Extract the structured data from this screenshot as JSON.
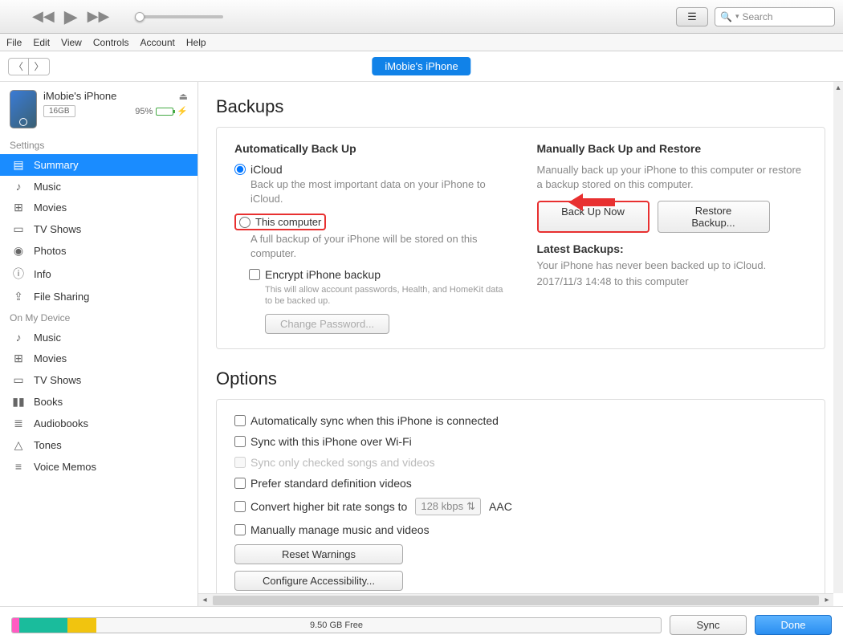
{
  "window": {
    "minimize": "–",
    "maximize": "☐",
    "close": "✕"
  },
  "toolbar": {
    "search_placeholder": "Search"
  },
  "menu": [
    "File",
    "Edit",
    "View",
    "Controls",
    "Account",
    "Help"
  ],
  "device_pill": "iMobie's iPhone",
  "device": {
    "name": "iMobie's iPhone",
    "capacity": "16GB",
    "battery_pct": "95%",
    "battery_fill": 95
  },
  "sidebar": {
    "settings_label": "Settings",
    "settings": [
      {
        "icon": "▤",
        "label": "Summary",
        "active": true
      },
      {
        "icon": "♪",
        "label": "Music"
      },
      {
        "icon": "⊞",
        "label": "Movies"
      },
      {
        "icon": "▭",
        "label": "TV Shows"
      },
      {
        "icon": "◉",
        "label": "Photos"
      },
      {
        "icon": "ⓘ",
        "label": "Info"
      },
      {
        "icon": "⇪",
        "label": "File Sharing"
      }
    ],
    "device_label": "On My Device",
    "device_items": [
      {
        "icon": "♪",
        "label": "Music"
      },
      {
        "icon": "⊞",
        "label": "Movies"
      },
      {
        "icon": "▭",
        "label": "TV Shows"
      },
      {
        "icon": "▮▮",
        "label": "Books"
      },
      {
        "icon": "≣",
        "label": "Audiobooks"
      },
      {
        "icon": "△",
        "label": "Tones"
      },
      {
        "icon": "≡",
        "label": "Voice Memos"
      }
    ]
  },
  "backups": {
    "title": "Backups",
    "auto_heading": "Automatically Back Up",
    "icloud_label": "iCloud",
    "icloud_desc": "Back up the most important data on your iPhone to iCloud.",
    "this_computer_label": "This computer",
    "this_computer_desc": "A full backup of your iPhone will be stored on this computer.",
    "encrypt_label": "Encrypt iPhone backup",
    "encrypt_desc": "This will allow account passwords, Health, and HomeKit data to be backed up.",
    "change_password": "Change Password...",
    "manual_heading": "Manually Back Up and Restore",
    "manual_desc": "Manually back up your iPhone to this computer or restore a backup stored on this computer.",
    "backup_now": "Back Up Now",
    "restore": "Restore Backup...",
    "latest_label": "Latest Backups:",
    "latest_line1": "Your iPhone has never been backed up to iCloud.",
    "latest_line2": "2017/11/3 14:48 to this computer"
  },
  "options": {
    "title": "Options",
    "auto_sync": "Automatically sync when this iPhone is connected",
    "wifi_sync": "Sync with this iPhone over Wi-Fi",
    "checked_only": "Sync only checked songs and videos",
    "sd_videos": "Prefer standard definition videos",
    "bitrate_prefix": "Convert higher bit rate songs to",
    "bitrate_value": "128 kbps",
    "bitrate_suffix": "AAC",
    "manual_manage": "Manually manage music and videos",
    "reset_warnings": "Reset Warnings",
    "configure_access": "Configure Accessibility..."
  },
  "bottom": {
    "storage_free": "9.50 GB Free",
    "sync": "Sync",
    "done": "Done",
    "segments": [
      {
        "color": "#ff5bc2",
        "pct": 1.5
      },
      {
        "color": "#1abc9c",
        "pct": 10
      },
      {
        "color": "#f1c40f",
        "pct": 6
      }
    ]
  }
}
